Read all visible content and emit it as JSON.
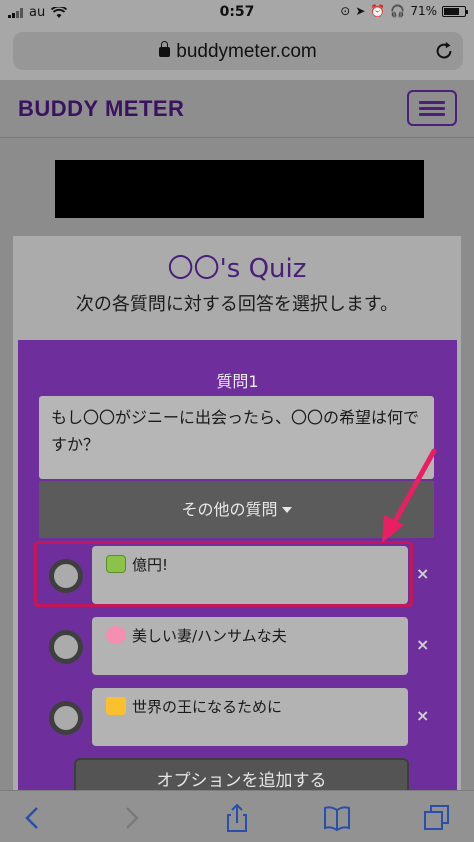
{
  "status": {
    "carrier": "au",
    "time": "0:57",
    "battery": "71%"
  },
  "browser": {
    "url": "buddymeter.com"
  },
  "site": {
    "brand": "BUDDY METER"
  },
  "quiz": {
    "title": "〇〇's Quiz",
    "subtitle": "次の各質問に対する回答を選択します。",
    "question_label": "質問1",
    "question_text": "もし〇〇がジニーに出会ったら、〇〇の希望は何ですか？",
    "more_questions": "その他の質問",
    "options": [
      {
        "text": "億円!",
        "icon": "money-emoji"
      },
      {
        "text": "美しい妻/ハンサムな夫",
        "icon": "couple-emoji"
      },
      {
        "text": "世界の王になるために",
        "icon": "crown-emoji"
      }
    ],
    "remove_symbol": "×",
    "add_option": "オプションを追加する"
  },
  "colors": {
    "brand_purple": "#6e2f9c",
    "highlight_pink": "#c2185b"
  }
}
